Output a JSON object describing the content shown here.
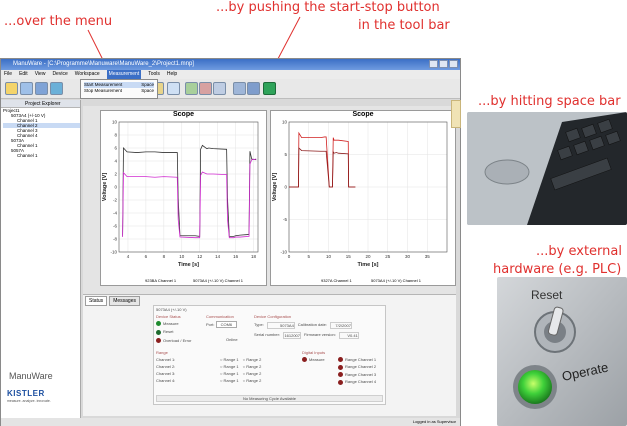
{
  "annotations": {
    "menu": "...over the menu",
    "toolbar_line1": "...by pushing the start-stop button",
    "toolbar_line2": "in the tool bar",
    "spacebar": "...by hitting space bar",
    "hardware_line1": "...by external",
    "hardware_line2": "hardware (e.g. PLC)"
  },
  "colors": {
    "annotation": "#e0302e",
    "accent": "#3b6fc6"
  },
  "window": {
    "title": "ManuWare - [C:\\Programme\\Manuware\\ManuWare_2\\Project1.mnp]"
  },
  "menu": {
    "items": [
      "File",
      "Edit",
      "View",
      "Device",
      "Workspace",
      "Measurement",
      "Tools",
      "Help"
    ],
    "dropdown": [
      "Start Measurement",
      "Stop Measurement"
    ],
    "shortcuts": [
      "Space",
      "Space"
    ]
  },
  "explorer": {
    "title": "Project Explorer",
    "tree": [
      "Project1",
      "5073A4 (+/-10 V)",
      "Channel 1",
      "Channel 2",
      "Channel 3",
      "Channel 4",
      "5073A",
      "Channel 1",
      "5057A",
      "Channel 1"
    ]
  },
  "chart_data": [
    {
      "type": "line",
      "title": "Scope",
      "xlabel": "Time [s]",
      "ylabel": "Voltage [V]",
      "xlim": [
        3,
        18.5
      ],
      "ylim": [
        -10,
        10
      ],
      "xticks": [
        4,
        6,
        8,
        10,
        12,
        14,
        16,
        18
      ],
      "yticks": [
        -10,
        -8,
        -6,
        -4,
        -2,
        0,
        2,
        4,
        6,
        8,
        10
      ],
      "series": [
        {
          "color": "#333333",
          "x": [
            3.4,
            3.5,
            3.9,
            5.0,
            6.0,
            7.0,
            8.0,
            9.5,
            9.6,
            9.8,
            11.5,
            12.0,
            12.1,
            12.3,
            12.8,
            13.0,
            13.5,
            15.0,
            15.1,
            15.3,
            15.8,
            16.0,
            16.5,
            17.5,
            17.6,
            17.8,
            18.3
          ],
          "y": [
            -7.5,
            6.0,
            5.4,
            5.3,
            5.4,
            5.4,
            5.3,
            5.3,
            -1.8,
            -7.5,
            -7.5,
            -7.6,
            5.8,
            6.4,
            5.9,
            6.0,
            5.9,
            5.8,
            -1.8,
            -7.6,
            -7.6,
            -7.5,
            -7.4,
            -7.3,
            5.5,
            4.3,
            4.2
          ]
        },
        {
          "color": "#d02ad0",
          "x": [
            3.4,
            3.5,
            3.9,
            5.0,
            6.0,
            7.0,
            8.0,
            9.5,
            9.6,
            9.8,
            11.5,
            12.0,
            12.1,
            12.3,
            12.8,
            13.0,
            13.5,
            15.0,
            15.1,
            15.3,
            15.8,
            16.0,
            16.5,
            17.5,
            17.6,
            17.8,
            18.3
          ],
          "y": [
            -7.7,
            2.2,
            1.6,
            1.6,
            1.6,
            1.5,
            1.6,
            1.5,
            -5.0,
            -7.7,
            -7.8,
            -7.8,
            1.8,
            2.3,
            2.0,
            2.0,
            2.0,
            1.9,
            -5.0,
            -7.8,
            -7.8,
            -7.7,
            -7.7,
            -7.6,
            3.5,
            4.2,
            4.3
          ]
        }
      ],
      "legend": [
        "923BA Channel 1",
        "5073A4 (+/-10 V) Channel 1"
      ]
    },
    {
      "type": "line",
      "title": "Scope",
      "xlabel": "Time [s]",
      "ylabel": "Voltage [V]",
      "xlim": [
        0,
        40
      ],
      "ylim": [
        -10,
        10
      ],
      "xticks": [
        0,
        5,
        10,
        15,
        20,
        25,
        30,
        35
      ],
      "yticks": [
        -10,
        -5,
        0,
        5,
        10
      ],
      "series": [
        {
          "color": "#d02020",
          "x": [
            0,
            2.4,
            2.5,
            3.2,
            8.0,
            9.0,
            9.4,
            10.2,
            11.0,
            11.2,
            11.4,
            12.0,
            12.5,
            15.0,
            15.1,
            16.0,
            16.8
          ],
          "y": [
            0,
            0,
            8.3,
            7.6,
            7.6,
            7.7,
            7.7,
            0,
            0,
            7.6,
            7.2,
            7.2,
            7.2,
            7.0,
            0,
            0,
            0
          ]
        },
        {
          "color": "#8b1a1a",
          "x": [
            0,
            2.4,
            2.5,
            3.2,
            8.0,
            9.0,
            9.4,
            10.2,
            11.0,
            11.2,
            11.4,
            12.0,
            12.5,
            15.0,
            15.1,
            16.0,
            16.8
          ],
          "y": [
            0,
            0,
            6.0,
            5.6,
            5.5,
            5.5,
            5.5,
            0,
            0,
            5.4,
            5.2,
            5.3,
            5.2,
            5.1,
            0,
            0,
            0
          ]
        }
      ],
      "legend": [
        "9327A Channel 1",
        "5073A4 (+/-10 V) Channel 1"
      ]
    }
  ],
  "status": {
    "tabs": [
      "Status",
      "Messages"
    ],
    "device": "5073A4 (+/-10 V)",
    "groups": [
      "Device Status",
      "Communication",
      "Device Configuration",
      "Range",
      "Digital Inputs"
    ],
    "device_status": [
      "Measure",
      "Reset",
      "Overload / Error"
    ],
    "comm": {
      "port_label": "Port:",
      "port_value": "COM6",
      "state": "Online"
    },
    "config": {
      "type_label": "Type:",
      "type_value": "5073A4",
      "cal_label": "Calibration date:",
      "cal_value": "7/2/2007",
      "serial_label": "Serial number:",
      "serial_value": "1612007",
      "fw_label": "Firmware version:",
      "fw_value": "V0.41"
    },
    "range_channels": [
      "Channel 1:",
      "Channel 2:",
      "Channel 3:",
      "Channel 4:"
    ],
    "range_opts": [
      "Range 1",
      "Range 2"
    ],
    "digital_inputs": [
      "Measure",
      "Range Channel 1",
      "Range Channel 2",
      "Range Channel 3",
      "Range Channel 4"
    ],
    "footer": "No Measuring Cycle Available",
    "login": "Logged in as Supervisor"
  },
  "brand": {
    "app": "ManuWare",
    "company": "KISTLER",
    "tagline": "measure. analyze. innovate."
  },
  "photos": {
    "spacebar": "laptop-keyboard-photo",
    "hardware": "toggle-switch-photo",
    "switch_top": "Reset",
    "switch_bottom": "Operate"
  }
}
